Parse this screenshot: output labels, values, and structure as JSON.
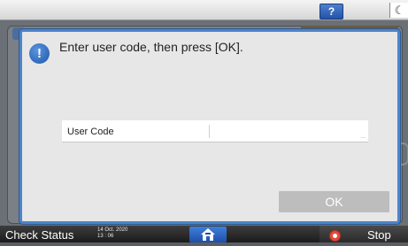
{
  "topbar": {
    "help_label": "?",
    "energy_icon": "moon-icon"
  },
  "dialog": {
    "icon": "info-icon",
    "icon_glyph": "!",
    "message": "Enter user code, then press [OK].",
    "field": {
      "label": "User Code",
      "value": "",
      "ellipsis": "..."
    },
    "ok_label": "OK",
    "ok_enabled": false
  },
  "bottombar": {
    "check_status_label": "Check Status",
    "date": "14 Oct. 2020",
    "time": "13 : 06",
    "home_icon": "home-icon",
    "stop_icon": "stop-icon",
    "stop_label": "Stop"
  },
  "colors": {
    "dialog_border": "#4d84cc",
    "home_button": "#2f6bd0",
    "ok_disabled": "#bdbdbd",
    "stop_icon": "#e24a3a"
  }
}
